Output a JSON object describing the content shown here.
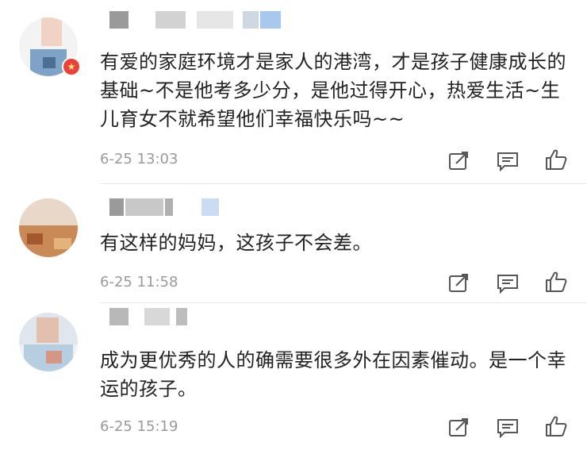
{
  "comments": [
    {
      "text": "有爱的家庭环境才是家人的港湾，才是孩子健康成长的基础~不是他考多少分，是他过得开心，热爱生活~生儿育女不就希望他们幸福快乐吗~~",
      "time": "6-25 13:03",
      "verified": true
    },
    {
      "text": "有这样的妈妈，这孩子不会差。",
      "time": "6-25 11:58",
      "verified": false
    },
    {
      "text": "成为更优秀的人的确需要很多外在因素催动。是一个幸运的孩子。",
      "time": "6-25 15:19",
      "verified": false
    }
  ],
  "icons": {
    "repost": "share-box-icon",
    "reply": "comment-icon",
    "like": "thumbs-up-icon"
  },
  "colors": {
    "time": "#9a9a9a",
    "icon": "#555555",
    "verified_badge": "#e8423b"
  }
}
